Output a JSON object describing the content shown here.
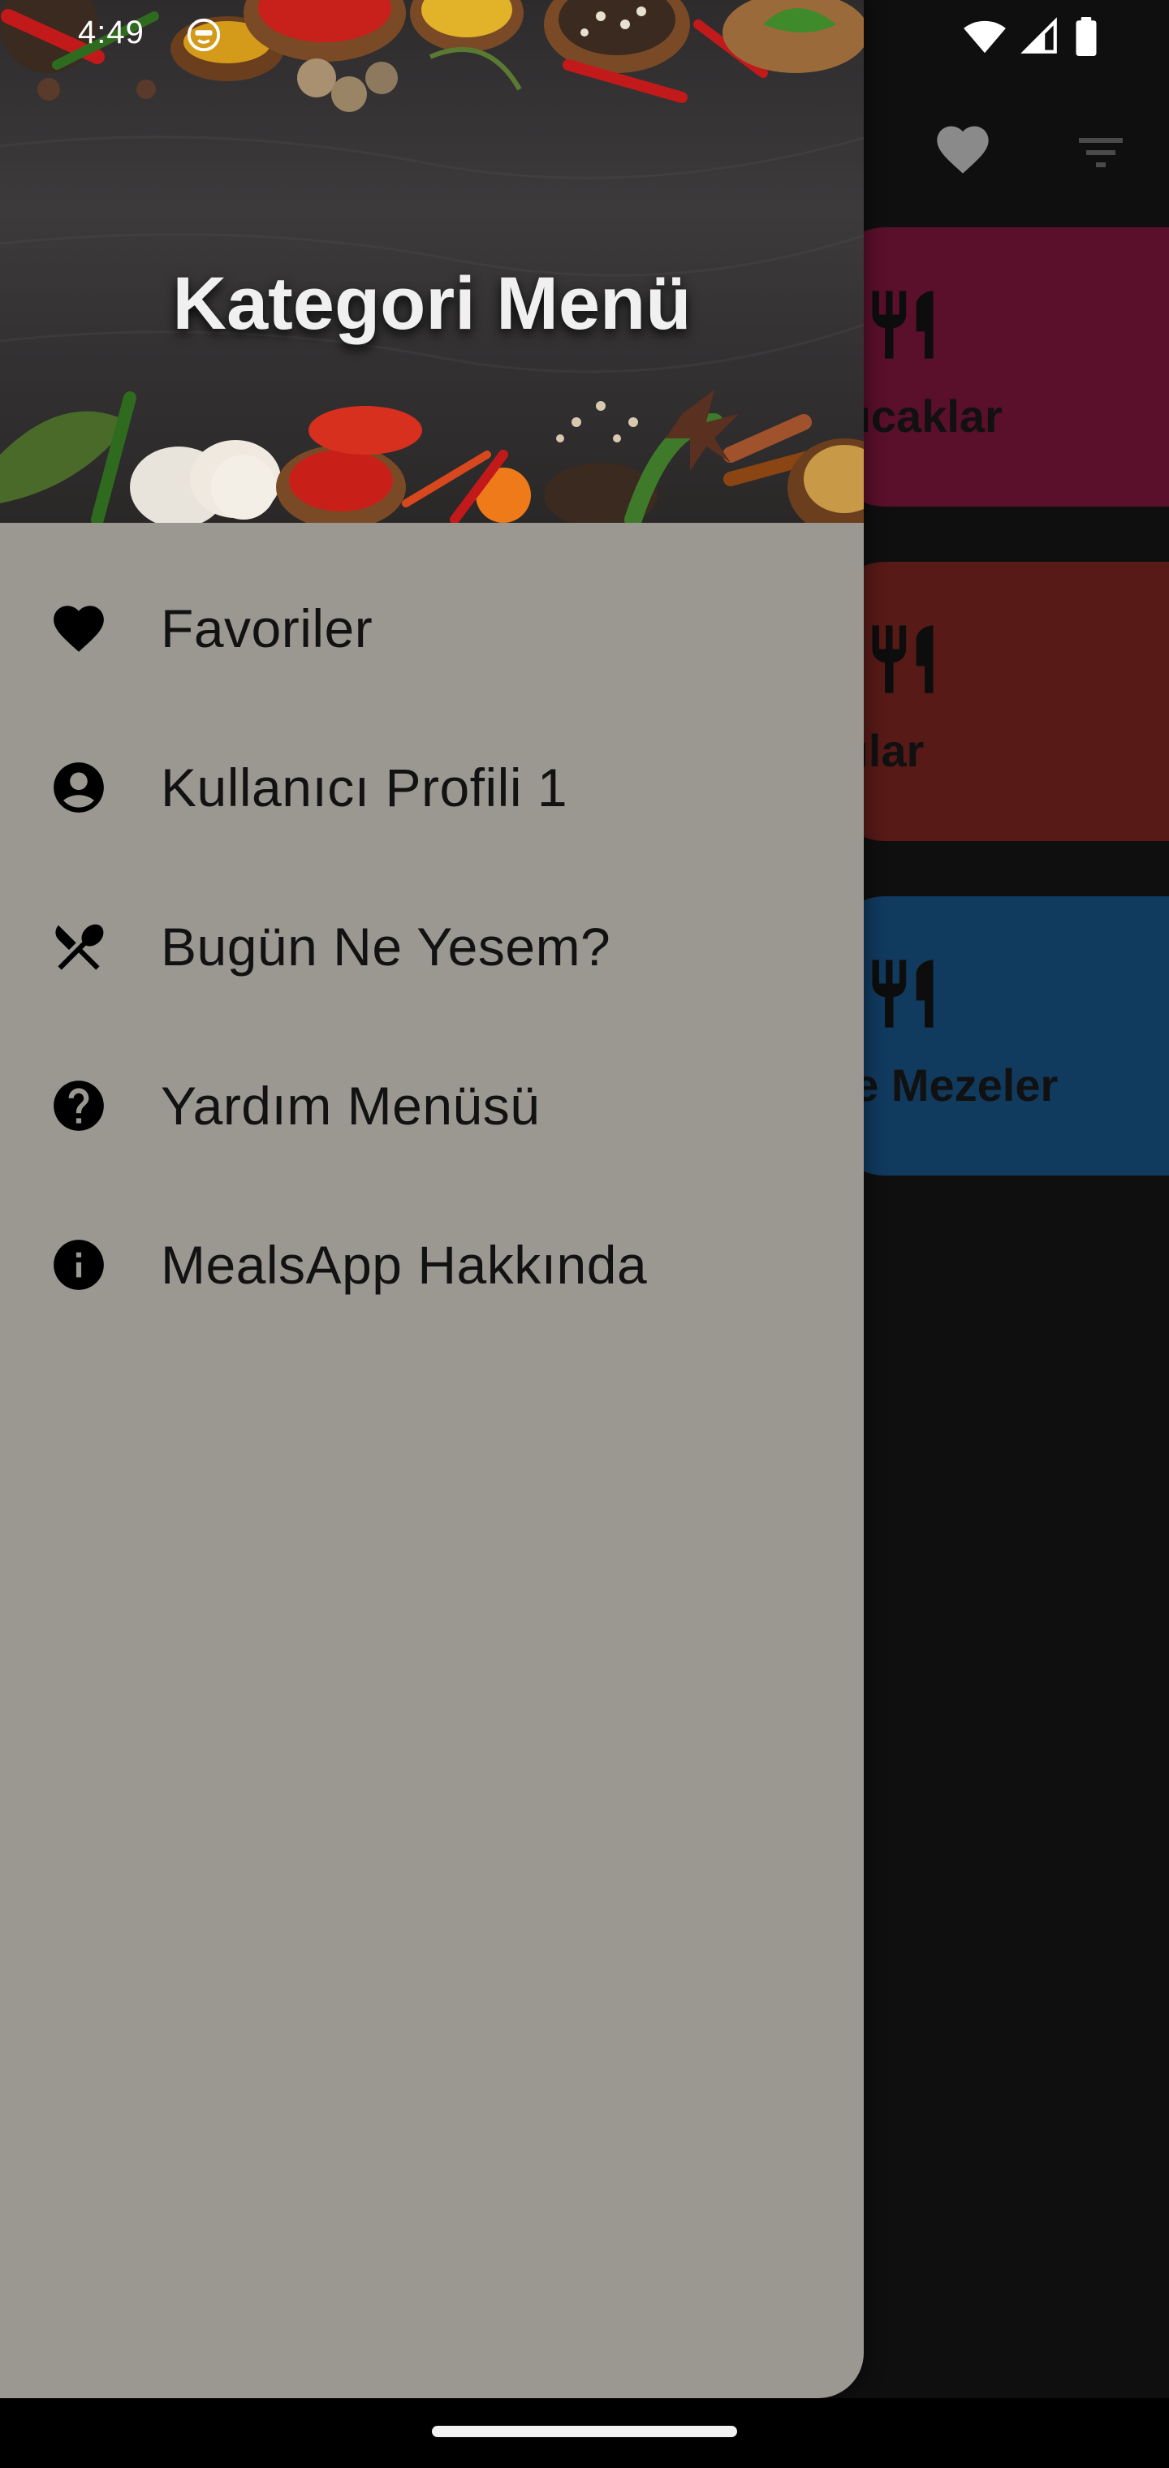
{
  "status_bar": {
    "time": "4:49",
    "left_icon": "face-icon",
    "right_icons": [
      "wifi-icon",
      "signal-icon",
      "battery-icon"
    ]
  },
  "app_bar": {
    "favorites_icon": "heart-icon",
    "filter_icon": "filter-icon"
  },
  "categories": [
    {
      "label": "Sıcaklar",
      "color": "#5a0f2b",
      "icon": "utensils-icon"
    },
    {
      "label": "tlılar",
      "color": "#571a17",
      "icon": "utensils-icon"
    },
    {
      "label": "ve Mezeler",
      "color": "#113a5f",
      "icon": "utensils-icon"
    }
  ],
  "drawer": {
    "header_title": "Kategori Menü",
    "background_color": "#9b9892",
    "items": [
      {
        "label": "Favoriler",
        "icon": "heart-icon"
      },
      {
        "label": "Kullanıcı Profili 1",
        "icon": "account-circle-icon"
      },
      {
        "label": "Bugün Ne Yesem?",
        "icon": "utensils-crossed-icon"
      },
      {
        "label": "Yardım Menüsü",
        "icon": "help-icon"
      },
      {
        "label": "MealsApp Hakkında",
        "icon": "info-icon"
      }
    ]
  }
}
